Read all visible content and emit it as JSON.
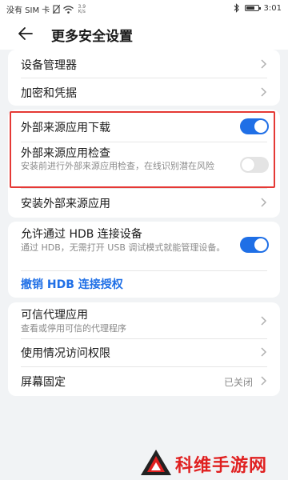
{
  "status_bar": {
    "carrier": "没有 SIM 卡",
    "net_speed_value": "3.9",
    "net_speed_unit": "K/s",
    "time": "3:01",
    "battery_level": 0.75
  },
  "header": {
    "title": "更多安全设置"
  },
  "group1": {
    "device_admin": "设备管理器",
    "encryption": "加密和凭据"
  },
  "group2": {
    "external_download": {
      "label": "外部来源应用下载",
      "enabled": true
    },
    "external_check": {
      "label": "外部来源应用检查",
      "description": "安装前进行外部来源应用检查，在线识别潜在风险",
      "enabled": false
    },
    "install_external": "安装外部来源应用"
  },
  "group3": {
    "hdb": {
      "label": "允许通过 HDB 连接设备",
      "description": "通过 HDB，无需打开 USB 调试模式就能管理设备。",
      "enabled": true
    },
    "revoke_hdb": "撤销 HDB 连接授权"
  },
  "group4": {
    "trust_agents": {
      "label": "可信代理应用",
      "description": "查看或停用可信的代理程序"
    },
    "usage_access": "使用情况访问权限",
    "screen_pinning": {
      "label": "屏幕固定",
      "value": "已关闭"
    }
  },
  "watermark": {
    "text": "科维手游网"
  },
  "colors": {
    "accent": "#1f6fe6",
    "highlight_border": "#e53935",
    "watermark": "#e02020"
  }
}
